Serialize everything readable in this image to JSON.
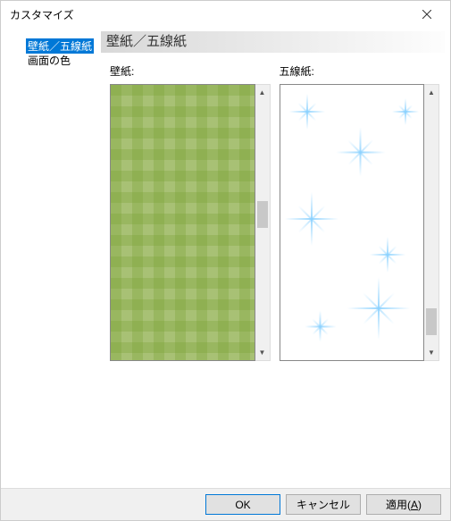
{
  "window": {
    "title": "カスタマイズ"
  },
  "sidebar": {
    "items": [
      {
        "label": "壁紙／五線紙",
        "selected": true
      },
      {
        "label": "画面の色",
        "selected": false
      }
    ]
  },
  "section": {
    "header": "壁紙／五線紙"
  },
  "panels": {
    "wallpaper": {
      "label": "壁紙:"
    },
    "staff": {
      "label": "五線紙:"
    }
  },
  "buttons": {
    "ok": "OK",
    "cancel": "キャンセル",
    "apply": "適用(",
    "apply_key": "A",
    "apply_suffix": ")"
  }
}
